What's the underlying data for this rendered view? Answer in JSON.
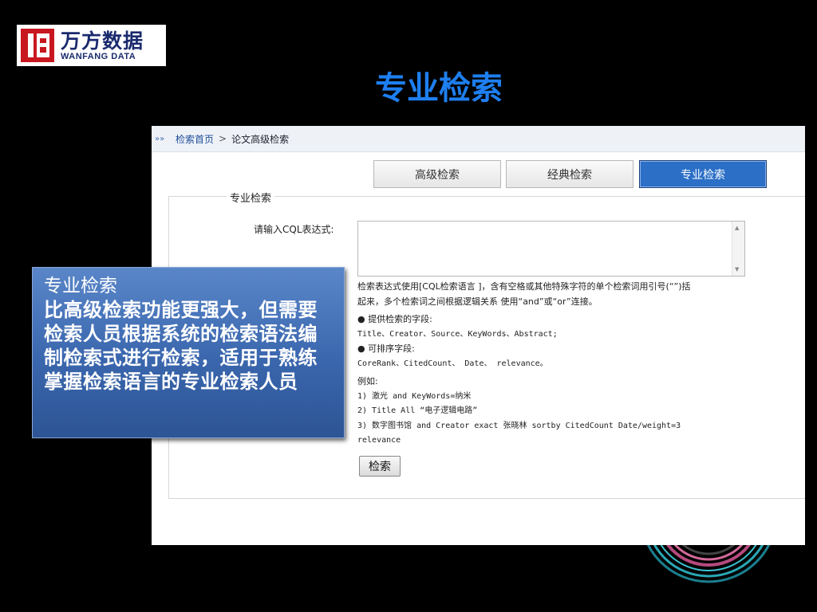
{
  "logo": {
    "cn": "万方数据",
    "en": "WANFANG DATA"
  },
  "slide": {
    "title": "专业检索"
  },
  "breadcrumb": {
    "home": "检索首页",
    "sep": ">",
    "current": "论文高级检索"
  },
  "tabs": [
    {
      "label": "高级检索",
      "active": false
    },
    {
      "label": "经典检索",
      "active": false
    },
    {
      "label": "专业检索",
      "active": true
    }
  ],
  "form": {
    "legend": "专业检索",
    "cql_label": "请输入CQL表达式:",
    "cql_value": "",
    "help": [
      "检索表达式使用[CQL检索语言 ]，含有空格或其他特殊字符的单个检索词用引号(“”)括",
      "起来，多个检索词之间根据逻辑关系 使用“and”或“or”连接。",
      "● 提供检索的字段:",
      "Title、Creator、Source、KeyWords、Abstract;",
      "● 可排序字段:",
      "CoreRank、CitedCount、 Date、 relevance。",
      "例如:",
      "1) 激光 and KeyWords=纳米",
      "2) Title All “电子逻辑电路”",
      "3) 数字图书馆 and Creator exact 张晓林 sortby CitedCount Date/weight=3",
      "relevance"
    ],
    "search_button": "检索"
  },
  "callout": {
    "title": "专业检索",
    "body": "比高级检索功能更强大，但需要检索人员根据系统的检索语法编制检索式进行检索，适用于熟练掌握检索语言的专业检索人员"
  },
  "colors": {
    "title": "#1e7ff0",
    "active_tab": "#2b6fc7",
    "callout": "#3a66ad",
    "logo_red": "#c8171e"
  }
}
